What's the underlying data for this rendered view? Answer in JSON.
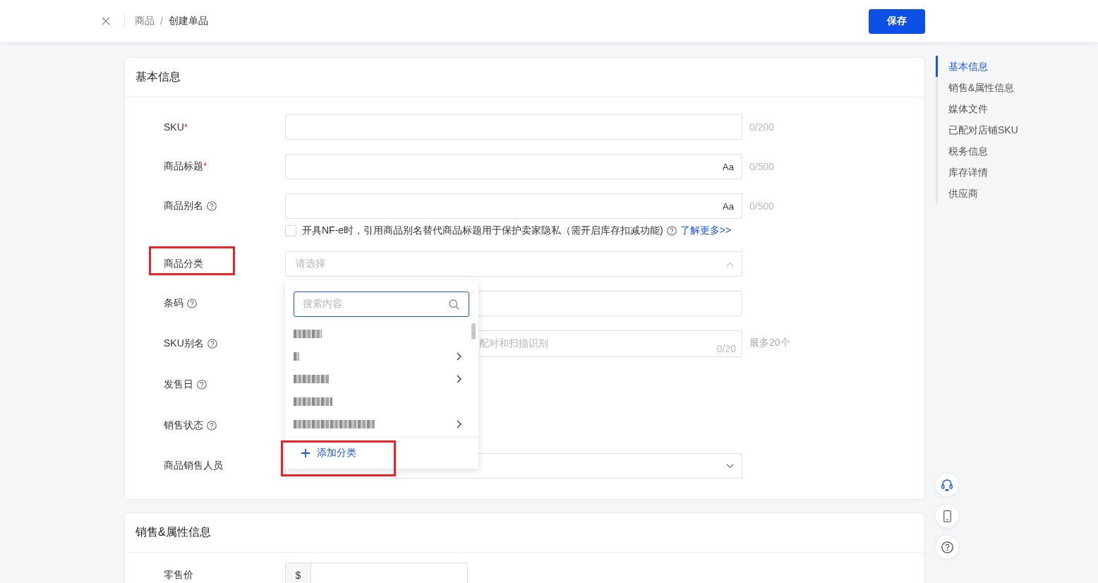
{
  "header": {
    "breadcrumb": [
      {
        "label": "商品",
        "current": false
      },
      {
        "label": "创建单品",
        "current": true
      }
    ],
    "separator": "/",
    "save_button": "保存"
  },
  "sections": [
    {
      "title": "基本信息",
      "fields": [
        {
          "label": "SKU",
          "required_mark": "*",
          "help": false,
          "highlighted": false,
          "kind": "text",
          "counter": "0/200"
        },
        {
          "label": "商品标题",
          "required_mark": "*",
          "help": false,
          "highlighted": false,
          "kind": "text",
          "suffix": "Aa",
          "counter": "0/500"
        },
        {
          "label": "商品别名",
          "help": true,
          "highlighted": false,
          "kind": "text",
          "suffix": "Aa",
          "counter": "0/500",
          "option": {
            "checked": false,
            "text": "开具NF-e时，引用商品别名替代商品标题用于保护卖家隐私（需开启库存扣减功能)",
            "help": true,
            "link": "了解更多>>"
          }
        },
        {
          "label": "商品分类",
          "help": false,
          "highlighted": true,
          "kind": "select",
          "placeholder": "请选择",
          "open": true,
          "dropdown": {
            "search_placeholder": "搜索内容",
            "search_focused": true,
            "items": [
              {
                "expandable": false
              },
              {
                "expandable": true
              },
              {
                "expandable": true
              },
              {
                "expandable": false
              },
              {
                "expandable": true
              }
            ],
            "add_button": {
              "label": "添加分类",
              "highlighted": true
            }
          }
        },
        {
          "label": "条码",
          "help": true,
          "highlighted": false,
          "kind": "text"
        },
        {
          "label": "SKU别名",
          "help": true,
          "highlighted": false,
          "kind": "textarea",
          "placeholder": "配对和扫描识别",
          "counter": "0/20",
          "note": "最多20个"
        },
        {
          "label": "发售日",
          "help": true,
          "highlighted": false
        },
        {
          "label": "销售状态",
          "help": true,
          "highlighted": false
        },
        {
          "label": "商品销售人员",
          "help": false,
          "highlighted": false,
          "kind": "select",
          "open": false
        }
      ]
    },
    {
      "title": "销售&属性信息",
      "fields": [
        {
          "label": "零售价",
          "help": false,
          "highlighted": false,
          "kind": "currency",
          "prefix": "$"
        }
      ]
    }
  ],
  "side_nav": {
    "items": [
      {
        "label": "基本信息",
        "selected": true
      },
      {
        "label": "销售&属性信息",
        "selected": false
      },
      {
        "label": "媒体文件",
        "selected": false
      },
      {
        "label": "已配对店铺SKU",
        "selected": false
      },
      {
        "label": "税务信息",
        "selected": false
      },
      {
        "label": "库存详情",
        "selected": false
      },
      {
        "label": "供应商",
        "selected": false
      }
    ]
  },
  "float_buttons": [
    {
      "kind": "support"
    },
    {
      "kind": "mobile"
    },
    {
      "kind": "help"
    }
  ]
}
